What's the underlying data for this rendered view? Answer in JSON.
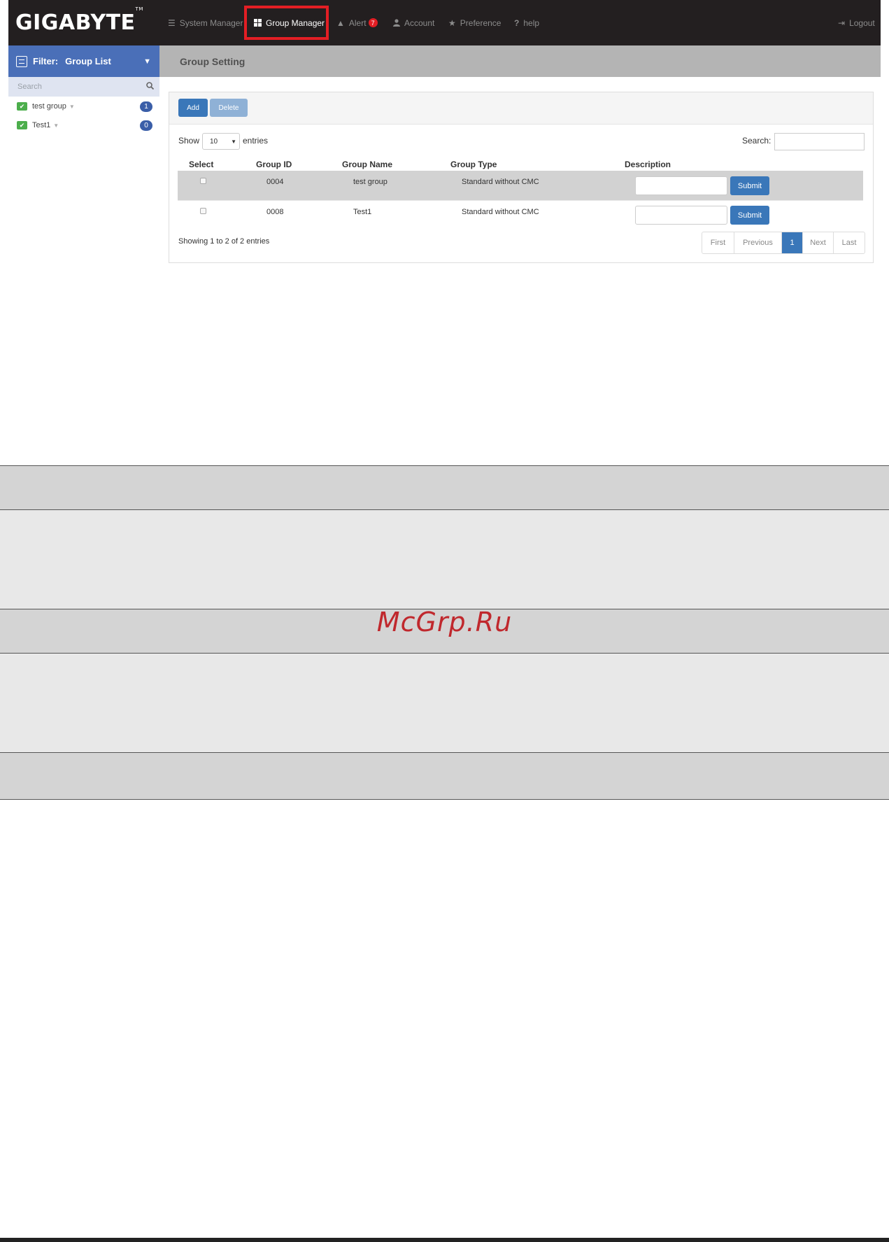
{
  "brand": {
    "logo": "GIGABYTE",
    "tm": "TM"
  },
  "nav": {
    "items": [
      {
        "label": "System Manager",
        "icon": "list-icon"
      },
      {
        "label": "Group Manager",
        "icon": "grid-icon",
        "active": true
      },
      {
        "label": "Alert",
        "icon": "warning-icon",
        "badge": "7"
      },
      {
        "label": "Account",
        "icon": "user-icon"
      },
      {
        "label": "Preference",
        "icon": "star-icon"
      },
      {
        "label": "help",
        "icon": "question-icon"
      }
    ],
    "logout": "Logout"
  },
  "sidebar": {
    "filter_label": "Filter:",
    "filter_value": "Group List",
    "search_placeholder": "Search",
    "groups": [
      {
        "name": "test group",
        "count": "1"
      },
      {
        "name": "Test1",
        "count": "0"
      }
    ]
  },
  "main": {
    "title": "Group Setting",
    "buttons": {
      "add": "Add",
      "delete": "Delete"
    },
    "length": {
      "show": "Show",
      "value": "10",
      "entries": "entries"
    },
    "search_label": "Search:",
    "table": {
      "headers": [
        "Select",
        "Group ID",
        "Group Name",
        "Group Type",
        "Description"
      ],
      "rows": [
        {
          "id": "0004",
          "name": "test group",
          "type": "Standard without CMC",
          "submit": "Submit"
        },
        {
          "id": "0008",
          "name": "Test1",
          "type": "Standard without CMC",
          "submit": "Submit"
        }
      ]
    },
    "info": "Showing 1 to 2 of 2 entries",
    "pagination": [
      "First",
      "Previous",
      "1",
      "Next",
      "Last"
    ]
  },
  "watermark": "McGrp.Ru",
  "colors": {
    "nav_bg": "#231f20",
    "accent": "#3a77b9",
    "filter_bg": "#4a6fb8",
    "highlight": "#e31e24"
  }
}
